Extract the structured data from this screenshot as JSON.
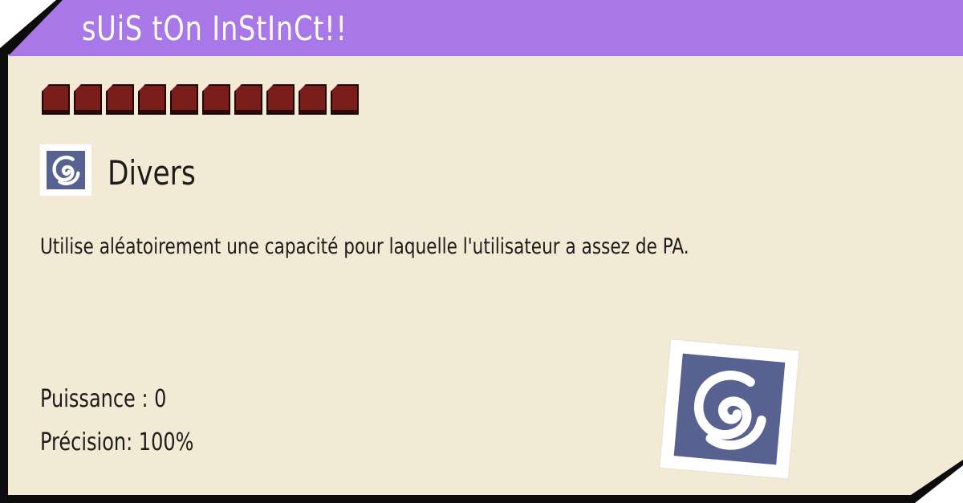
{
  "header": {
    "title": "sUiS tOn InStInCt!!"
  },
  "pp": {
    "current": 10,
    "max": 10
  },
  "type": {
    "label": "Divers",
    "icon": "status-swirl-icon"
  },
  "description": "Utilise aléatoirement une capacité pour laquelle l'utilisateur a assez de PA.",
  "stats": {
    "power": "Puissance : 0",
    "accuracy": "Précision: 100%"
  },
  "colors": {
    "title_bar": "#a878e8",
    "card_background": "#f2ead5",
    "pip_fill": "#7a1c17",
    "category_badge": "#576291"
  }
}
